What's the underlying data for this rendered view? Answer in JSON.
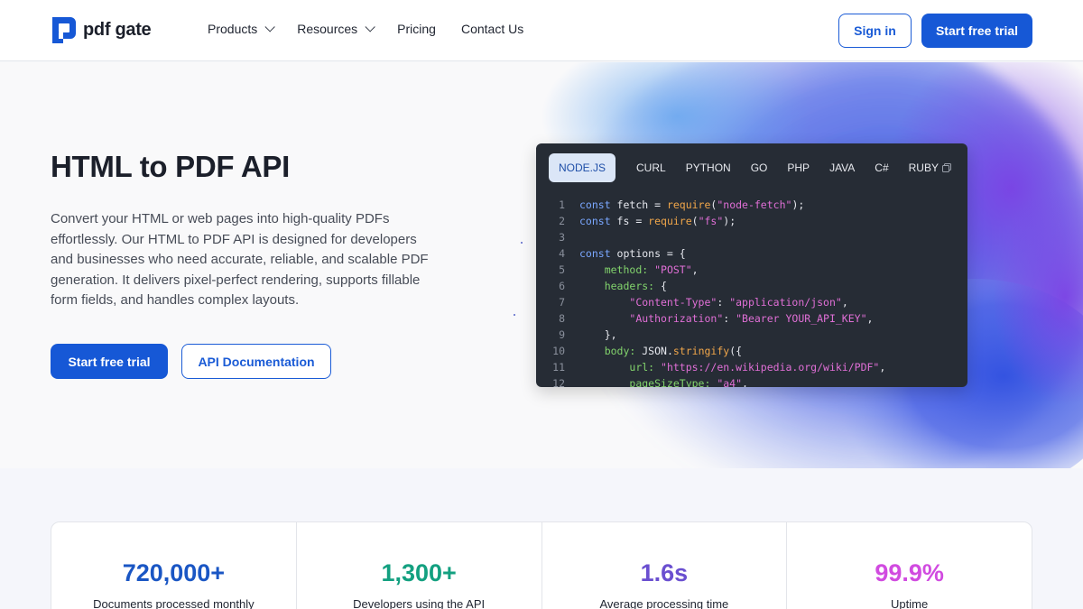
{
  "brand": {
    "name": "pdf gate",
    "accent": "#1658d6"
  },
  "nav": {
    "items": [
      {
        "label": "Products",
        "has_dropdown": true
      },
      {
        "label": "Resources",
        "has_dropdown": true
      },
      {
        "label": "Pricing",
        "has_dropdown": false
      },
      {
        "label": "Contact Us",
        "has_dropdown": false
      }
    ],
    "sign_in": "Sign in",
    "start_trial": "Start free trial"
  },
  "hero": {
    "title": "HTML to PDF API",
    "description": "Convert your HTML or web pages into high-quality PDFs effortlessly. Our HTML to PDF API is designed for developers and businesses who need accurate, reliable, and scalable PDF generation. It delivers pixel-perfect rendering, supports fillable form fields, and handles complex layouts.",
    "primary_cta": "Start free trial",
    "secondary_cta": "API Documentation"
  },
  "code": {
    "tabs": [
      "NODE.JS",
      "CURL",
      "PYTHON",
      "GO",
      "PHP",
      "JAVA",
      "C#",
      "RUBY"
    ],
    "active_tab": "NODE.JS",
    "copy_icon": "copy-icon",
    "lines": [
      {
        "n": "1",
        "tokens": [
          [
            "kw",
            "const "
          ],
          [
            "id",
            "fetch = "
          ],
          [
            "fn",
            "require"
          ],
          [
            "pun",
            "("
          ],
          [
            "str",
            "\"node-fetch\""
          ],
          [
            "pun",
            ");"
          ]
        ]
      },
      {
        "n": "2",
        "tokens": [
          [
            "kw",
            "const "
          ],
          [
            "id",
            "fs = "
          ],
          [
            "fn",
            "require"
          ],
          [
            "pun",
            "("
          ],
          [
            "str",
            "\"fs\""
          ],
          [
            "pun",
            ");"
          ]
        ]
      },
      {
        "n": "3",
        "tokens": []
      },
      {
        "n": "4",
        "tokens": [
          [
            "kw",
            "const "
          ],
          [
            "id",
            "options = {"
          ]
        ]
      },
      {
        "n": "5",
        "tokens": [
          [
            "id",
            "    "
          ],
          [
            "prop",
            "method: "
          ],
          [
            "str",
            "\"POST\""
          ],
          [
            "pun",
            ","
          ]
        ]
      },
      {
        "n": "6",
        "tokens": [
          [
            "id",
            "    "
          ],
          [
            "prop",
            "headers: "
          ],
          [
            "pun",
            "{"
          ]
        ]
      },
      {
        "n": "7",
        "tokens": [
          [
            "id",
            "        "
          ],
          [
            "str",
            "\"Content-Type\""
          ],
          [
            "pun",
            ": "
          ],
          [
            "str",
            "\"application/json\""
          ],
          [
            "pun",
            ","
          ]
        ]
      },
      {
        "n": "8",
        "tokens": [
          [
            "id",
            "        "
          ],
          [
            "str",
            "\"Authorization\""
          ],
          [
            "pun",
            ": "
          ],
          [
            "str",
            "\"Bearer YOUR_API_KEY\""
          ],
          [
            "pun",
            ","
          ]
        ]
      },
      {
        "n": "9",
        "tokens": [
          [
            "id",
            "    "
          ],
          [
            "pun",
            "},"
          ]
        ]
      },
      {
        "n": "10",
        "tokens": [
          [
            "id",
            "    "
          ],
          [
            "prop",
            "body: "
          ],
          [
            "id",
            "JSON."
          ],
          [
            "fn",
            "stringify"
          ],
          [
            "pun",
            "({"
          ]
        ]
      },
      {
        "n": "11",
        "tokens": [
          [
            "id",
            "        "
          ],
          [
            "prop",
            "url: "
          ],
          [
            "str",
            "\"https://en.wikipedia.org/wiki/PDF\""
          ],
          [
            "pun",
            ","
          ]
        ]
      },
      {
        "n": "12",
        "tokens": [
          [
            "id",
            "        "
          ],
          [
            "prop",
            "pageSizeType: "
          ],
          [
            "str",
            "\"a4\""
          ],
          [
            "pun",
            ","
          ]
        ]
      }
    ]
  },
  "stats": [
    {
      "value": "720,000+",
      "label": "Documents processed monthly",
      "color": "#1a56c4"
    },
    {
      "value": "1,300+",
      "label": "Developers using the API",
      "color": "#13a080"
    },
    {
      "value": "1.6s",
      "label": "Average processing time",
      "color": "#6a4fd0"
    },
    {
      "value": "99.9%",
      "label": "Uptime",
      "color": "#d14be0"
    }
  ]
}
